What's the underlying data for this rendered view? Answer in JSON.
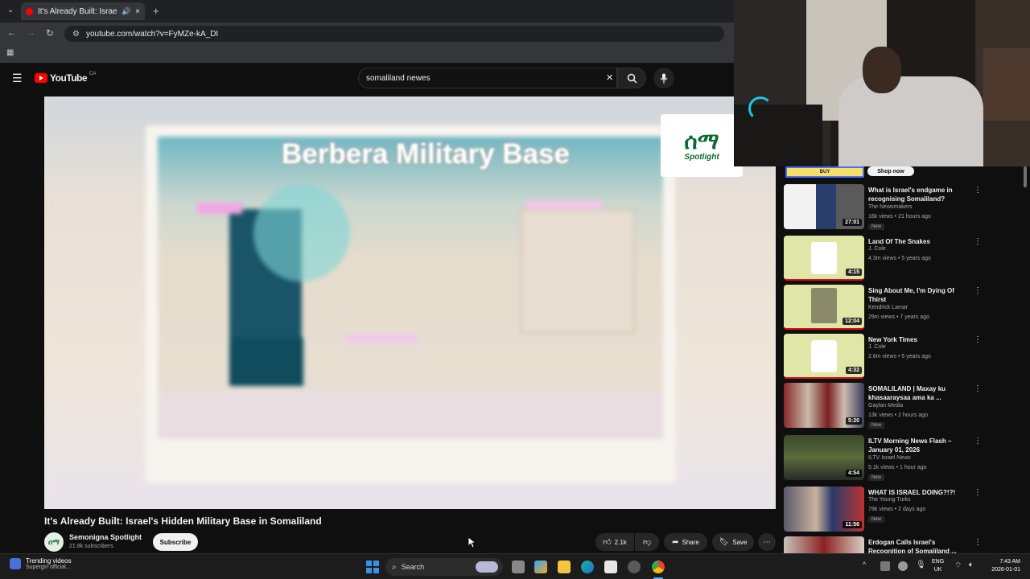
{
  "browser": {
    "tab_title": "It's Already Built: Israel's Hi",
    "url": "youtube.com/watch?v=FyMZe-kA_DI"
  },
  "youtube": {
    "logo_text": "YouTube",
    "region": "CA",
    "search_value": "somaliland newes"
  },
  "video": {
    "overlay_title": "Berbera Military Base",
    "watermark": "Spotlight",
    "title": "It's Already Built: Israel's Hidden Military Base in Somaliland",
    "channel": "Semonigna Spotlight",
    "subscribers": "21.8k subscribers",
    "subscribe_label": "Subscribe",
    "likes": "2.1k",
    "share_label": "Share",
    "save_label": "Save"
  },
  "sidebar": {
    "top_partial": {
      "buy": "BUY",
      "shop_now": "Shop now"
    },
    "items": [
      {
        "title": "What is Israel's endgame in recognising Somaliland?",
        "channel": "The Newsmakers",
        "meta": "16k views • 21 hours ago",
        "duration": "27:01",
        "badge": "New"
      },
      {
        "title": "Land Of The Snakes",
        "channel": "J. Cole",
        "meta": "4.3m views • 5 years ago",
        "duration": "4:15",
        "badge": ""
      },
      {
        "title": "Sing About Me, I'm Dying Of Thirst",
        "channel": "Kendrick Lamar",
        "meta": "29m views • 7 years ago",
        "duration": "12:04",
        "badge": ""
      },
      {
        "title": "New York Times",
        "channel": "J. Cole",
        "meta": "2.6m views • 5 years ago",
        "duration": "4:32",
        "badge": ""
      },
      {
        "title": "SOMALILAND | Maxay ku khasaaraysaa ama ka ...",
        "channel": "Gaylan Media",
        "meta": "13k views • 2 hours ago",
        "duration": "5:20",
        "badge": "New"
      },
      {
        "title": "ILTV Morning News Flash – January 01, 2026",
        "channel": "ILTV Israel News",
        "meta": "5.1k views • 1 hour ago",
        "duration": "4:54",
        "badge": "New"
      },
      {
        "title": "WHAT IS ISRAEL DOING?!?!",
        "channel": "The Young Turks",
        "meta": "79k views • 2 days ago",
        "duration": "11:56",
        "badge": "New"
      },
      {
        "title": "Erdogan Calls Israel's Recognition of Somaliland ...",
        "channel": "",
        "meta": "",
        "duration": "",
        "badge": ""
      }
    ]
  },
  "taskbar": {
    "widget_title": "Trending videos",
    "widget_sub": "Supergirl official...",
    "search_label": "Search",
    "lang_top": "ENG",
    "lang_bottom": "UK",
    "time": "7:43 AM",
    "date": "2026-01-01"
  },
  "icons": [
    "back-icon",
    "forward-icon",
    "reload-icon",
    "menu-icon",
    "search-icon",
    "mic-icon",
    "close-icon",
    "like-icon",
    "dislike-icon",
    "share-icon",
    "save-icon",
    "more-icon",
    "kebab-icon",
    "windows-icon"
  ]
}
